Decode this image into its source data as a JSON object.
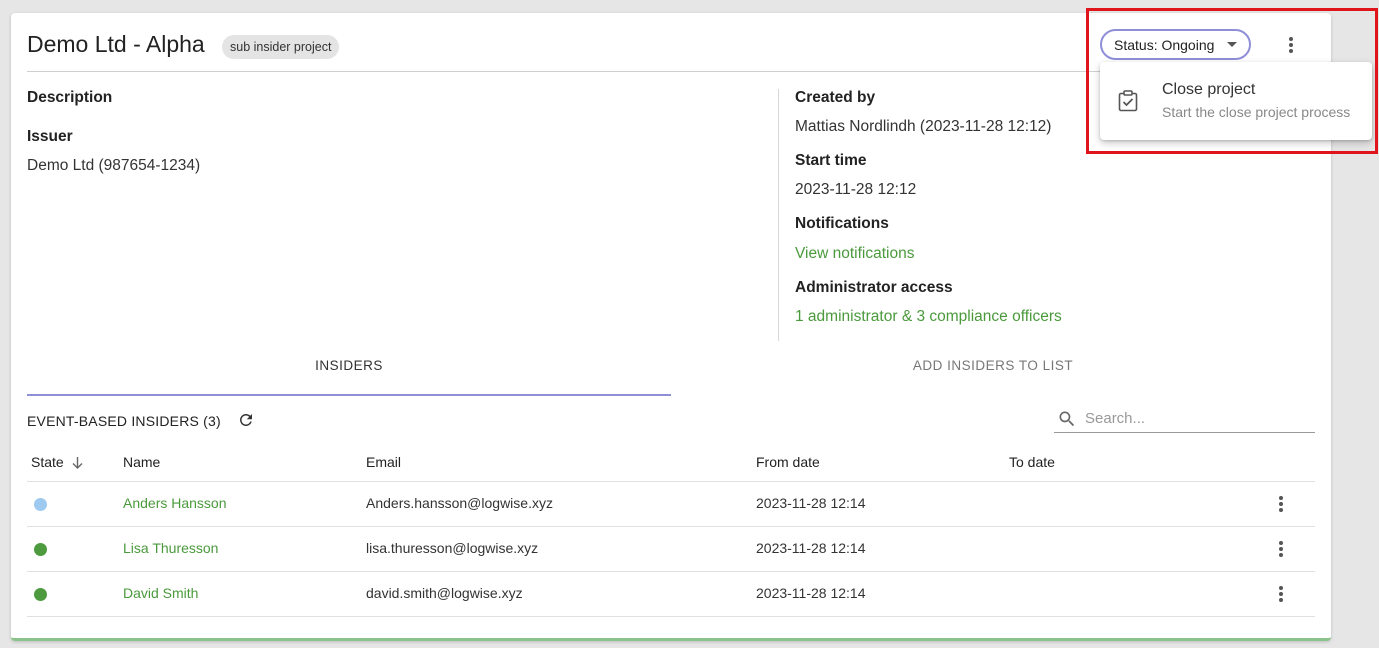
{
  "project": {
    "title": "Demo Ltd - Alpha",
    "badge": "sub insider project",
    "status_label": "Status: Ongoing"
  },
  "details": {
    "description_label": "Description",
    "issuer_label": "Issuer",
    "issuer_value": "Demo Ltd (987654-1234)",
    "created_by_label": "Created by",
    "created_by_value": "Mattias Nordlindh (2023-11-28 12:12)",
    "start_time_label": "Start time",
    "start_time_value": "2023-11-28 12:12",
    "notifications_label": "Notifications",
    "notifications_link": "View notifications",
    "admin_access_label": "Administrator access",
    "admin_access_link": "1 administrator & 3 compliance officers"
  },
  "tabs": [
    {
      "label": "INSIDERS",
      "active": true
    },
    {
      "label": "ADD INSIDERS TO LIST",
      "active": false
    }
  ],
  "insiders": {
    "section_title": "EVENT-BASED INSIDERS (3)",
    "search_placeholder": "Search...",
    "columns": [
      "State",
      "Name",
      "Email",
      "From date",
      "To date"
    ],
    "rows": [
      {
        "state_color": "#9ec9f0",
        "name": "Anders Hansson",
        "email": "Anders.hansson@logwise.xyz",
        "from": "2023-11-28 12:14",
        "to": ""
      },
      {
        "state_color": "#4e9b3f",
        "name": "Lisa Thuresson",
        "email": "lisa.thuresson@logwise.xyz",
        "from": "2023-11-28 12:14",
        "to": ""
      },
      {
        "state_color": "#4e9b3f",
        "name": "David Smith",
        "email": "david.smith@logwise.xyz",
        "from": "2023-11-28 12:14",
        "to": ""
      }
    ]
  },
  "menu": {
    "item_title": "Close project",
    "item_subtitle": "Start the close project process"
  },
  "colors": {
    "accent": "#8f8fd8",
    "link": "#4a9a3c",
    "highlight": "#e0151c"
  }
}
